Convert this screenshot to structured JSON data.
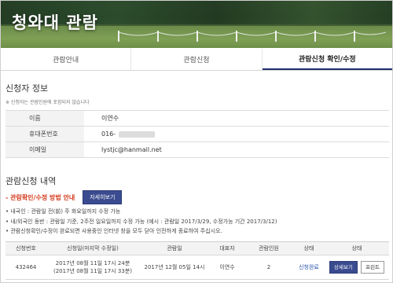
{
  "banner": {
    "title": "청와대 관람"
  },
  "tabs": [
    {
      "label": "관람안내"
    },
    {
      "label": "관람신청"
    },
    {
      "label": "관람신청 확인/수정"
    }
  ],
  "applicant": {
    "section_title": "신청자 정보",
    "note": "※ 신청자는 관람인원에 포함되지 않습니다",
    "rows": [
      {
        "label": "이름",
        "value": "이연수"
      },
      {
        "label": "휴대폰번호",
        "value": "016-"
      },
      {
        "label": "이메일",
        "value": "lystjc@hanmail.net"
      }
    ]
  },
  "history": {
    "section_title": "관람신청 내역",
    "guide_label": "- 관람확인/수정 방법 안내",
    "guide_button": "자세히보기",
    "bullets": [
      "• 내국인 : 관람일 전(前) 주 화요일까지 수정 가능",
      "• 내/외국인 동반 : 관람일 기준, 2주전 일요일까지 수정 가능 (예시 : 관람일 2017/3/29, 수정가능 기간 2017/3/12)",
      "• 관람신청확인/수정이 완료되면 사용중인 인터넷 창을 모두 닫아 인전하게 종료하여 주십시오."
    ],
    "table": {
      "headers": [
        "신청번호",
        "신청일(마지막 수정일)",
        "관람일",
        "대표자",
        "관람인원",
        "상태",
        "상태"
      ],
      "rows": [
        {
          "no": "432464",
          "applied": "2017년 08월 11일 17시 24분",
          "modified": "(2017년 08월 11일 17시 33분)",
          "visit": "2017년 12월 05일 14시",
          "rep": "이연수",
          "count": "2",
          "status": "신청완료",
          "btn_detail": "상세보기",
          "btn_print": "프린트"
        }
      ]
    }
  }
}
